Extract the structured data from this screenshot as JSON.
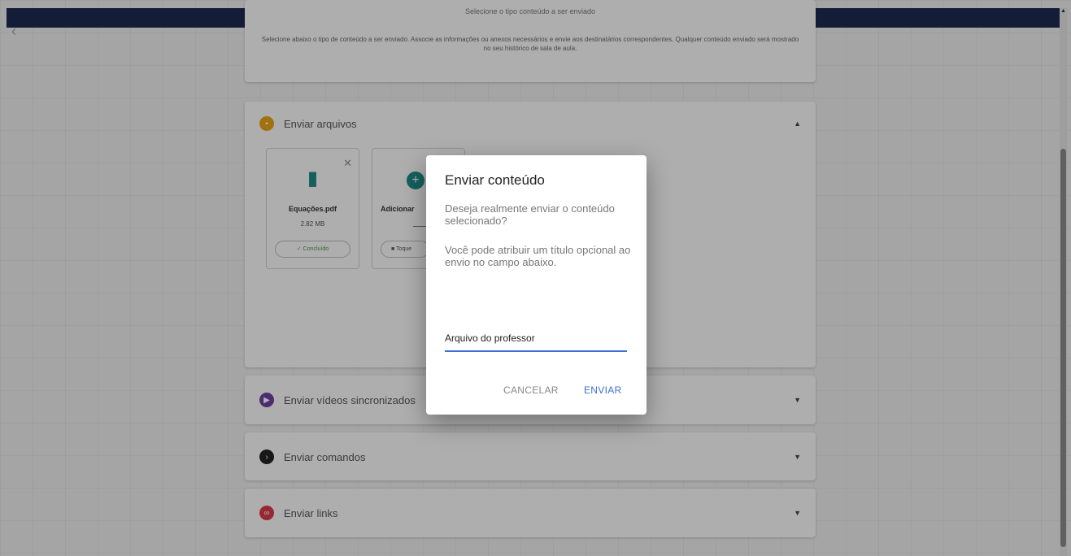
{
  "colors": {
    "navy": "#1e2a4f",
    "accent_blue": "#3f6fd8",
    "teal": "#1e8a84",
    "success_green": "#4a9a4a",
    "files_icon": "#e8a317",
    "videos_icon": "#6b3fa0",
    "commands_icon": "#222222",
    "links_icon": "#d93a4a"
  },
  "intro": {
    "title": "Selecione o tipo conteúdo a ser enviado",
    "description": "Selecione abaixo o tipo de conteúdo a ser enviado. Associe as informações ou anexos necessários e envie aos destinatários correspondentes. Qualquer conteúdo enviado será mostrado no seu histórico de sala de aula."
  },
  "panels": {
    "files": {
      "title": "Enviar arquivos",
      "icon": "folder-icon",
      "expanded": true
    },
    "videos": {
      "title": "Enviar vídeos sincronizados",
      "icon": "video-icon",
      "expanded": false
    },
    "commands": {
      "title": "Enviar comandos",
      "icon": "terminal-icon",
      "expanded": false
    },
    "links": {
      "title": "Enviar links",
      "icon": "link-icon",
      "expanded": false
    }
  },
  "files": [
    {
      "name": "Equações.pdf",
      "size": "2.82 MB",
      "status": "Concluído",
      "icon": "document-icon"
    }
  ],
  "add_file": {
    "label": "Adicionar",
    "button": "Toque",
    "icon": "plus-icon"
  },
  "dialog": {
    "title": "Enviar conteúdo",
    "question": "Deseja realmente enviar o conteúdo selecionado?",
    "info": "Você pode atribuir um título opcional ao envio no campo abaixo.",
    "input_value": "Arquivo do professor",
    "cancel_label": "CANCELAR",
    "send_label": "ENVIAR"
  }
}
